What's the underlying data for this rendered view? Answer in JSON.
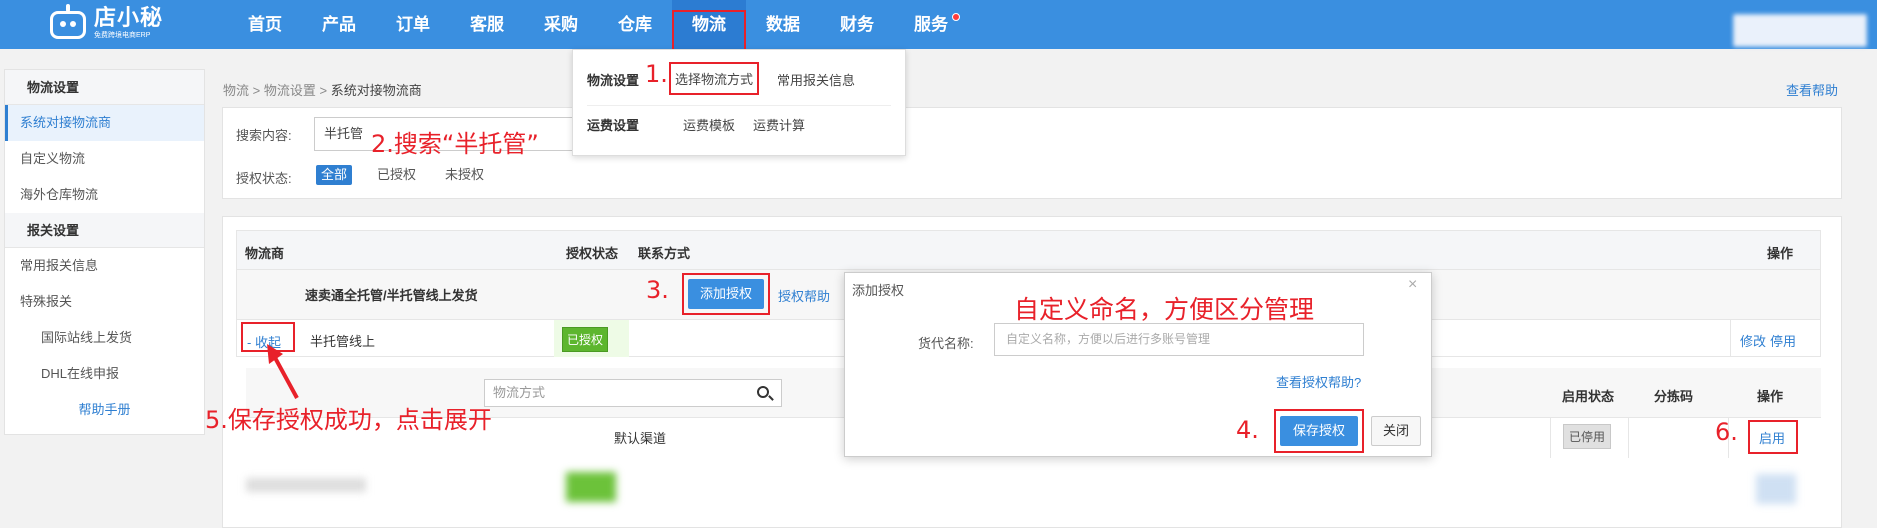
{
  "brand": {
    "name": "店小秘",
    "tagline": "免费跨境电商ERP"
  },
  "nav": {
    "items": [
      "首页",
      "产品",
      "订单",
      "客服",
      "采购",
      "仓库",
      "物流",
      "数据",
      "财务",
      "服务"
    ],
    "active": "物流"
  },
  "dropdown": {
    "group1_label": "物流设置",
    "group1_items": [
      "选择物流方式",
      "常用报关信息"
    ],
    "group2_label": "运费设置",
    "group2_items": [
      "运费模板",
      "运费计算"
    ]
  },
  "sidebar": {
    "section1": "物流设置",
    "section1_items": [
      "系统对接物流商",
      "自定义物流",
      "海外仓库物流"
    ],
    "section2": "报关设置",
    "section2_items": [
      "常用报关信息",
      "特殊报关"
    ],
    "special_items": [
      "国际站线上发货",
      "DHL在线申报"
    ],
    "help": "帮助手册"
  },
  "breadcrumb": {
    "p1": "物流",
    "p2": "物流设置",
    "current": "系统对接物流商",
    "sep": ">"
  },
  "help_link": "查看帮助",
  "search": {
    "label": "搜索内容:",
    "value": "半托管",
    "status_label": "授权状态:",
    "filters": [
      "全部",
      "已授权",
      "未授权"
    ],
    "active_filter": "全部"
  },
  "table": {
    "headers": {
      "carrier": "物流商",
      "auth_status": "授权状态",
      "contact": "联系方式",
      "action": "操作"
    },
    "group_name": "速卖通全托管/半托管线上发货",
    "add_auth": "添加授权",
    "auth_help": "授权帮助",
    "row": {
      "toggle": "- 收起",
      "name": "半托管线上",
      "status": "已授权",
      "edit": "修改",
      "disable": "停用"
    },
    "sub": {
      "search_placeholder": "物流方式",
      "headers": {
        "enabled": "启用状态",
        "sort_code": "分拣码",
        "action": "操作"
      },
      "row": {
        "name": "默认渠道",
        "status": "已停用",
        "action": "启用"
      }
    }
  },
  "modal": {
    "title": "添加授权",
    "close": "×",
    "field_label": "货代名称:",
    "placeholder": "自定义名称，方便以后进行多账号管理",
    "help_link": "查看授权帮助?",
    "save": "保存授权",
    "cancel": "关闭"
  },
  "annotations": {
    "step1": "1.",
    "step2": "2.搜索“半托管”",
    "step3": "3.",
    "step4": "4.",
    "step5": "5.保存授权成功，点击展开",
    "step6": "6.",
    "naming_tip": "自定义命名，方便区分管理"
  },
  "colors": {
    "primary": "#3a8fe0",
    "annotation": "#e8212a",
    "success": "#5db62e"
  }
}
